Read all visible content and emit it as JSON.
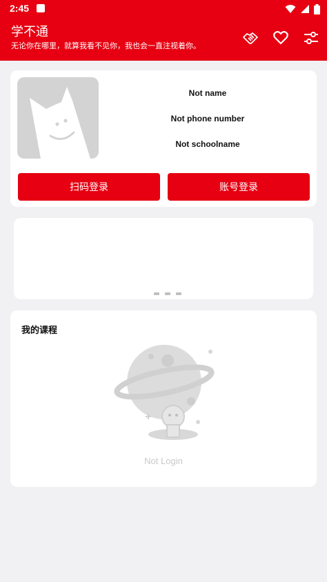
{
  "status_bar": {
    "time": "2:45"
  },
  "header": {
    "title": "学不通",
    "subtitle": "无论你在哪里，就算我看不见你，我也会一直注视着你。"
  },
  "profile": {
    "name": "Not name",
    "phone": "Not phone number",
    "school": "Not schoolname",
    "scan_login_label": "扫码登录",
    "account_login_label": "账号登录"
  },
  "courses": {
    "title": "我的课程",
    "empty_text": "Not Login"
  },
  "colors": {
    "accent": "#e60012",
    "background": "#f1f0f2"
  }
}
